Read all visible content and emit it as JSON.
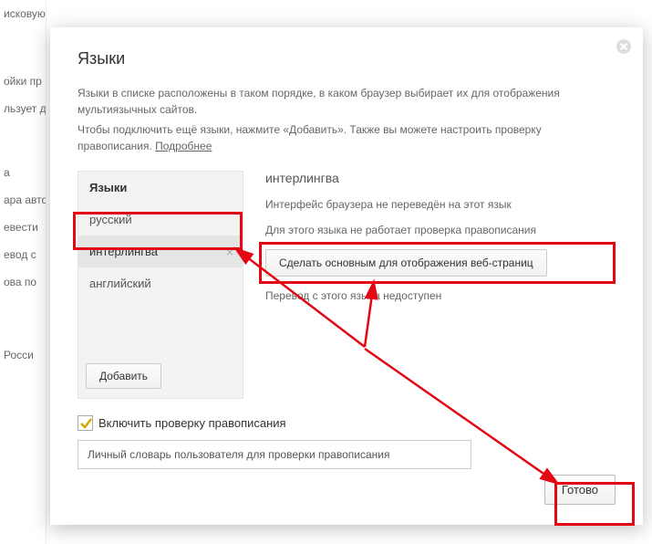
{
  "bg": {
    "items": [
      "исковую",
      "ойки пр",
      "льзует д",
      "а",
      "ара авток",
      "евести",
      "евод с",
      "ова по",
      "Росси"
    ]
  },
  "modal": {
    "title": "Языки",
    "desc1": "Языки в списке расположены в таком порядке, в каком браузер выбирает их для отображения мультиязычных сайтов.",
    "desc2_a": "Чтобы подключить ещё языки, нажмите «Добавить». Также вы можете настроить проверку правописания. ",
    "desc2_link": "Подробнее"
  },
  "list": {
    "header": "Языки",
    "items": [
      "русский",
      "интерлингва",
      "английский"
    ],
    "add": "Добавить"
  },
  "details": {
    "title": "интерлингва",
    "line1": "Интерфейс браузера не переведён на этот язык",
    "line2": "Для этого языка не работает проверка правописания",
    "button": "Сделать основным для отображения веб-страниц",
    "line3": "Перевод с этого языка недоступен"
  },
  "spell": {
    "label": "Включить проверку правописания",
    "dict": "Личный словарь пользователя для проверки правописания"
  },
  "done": "Готово"
}
